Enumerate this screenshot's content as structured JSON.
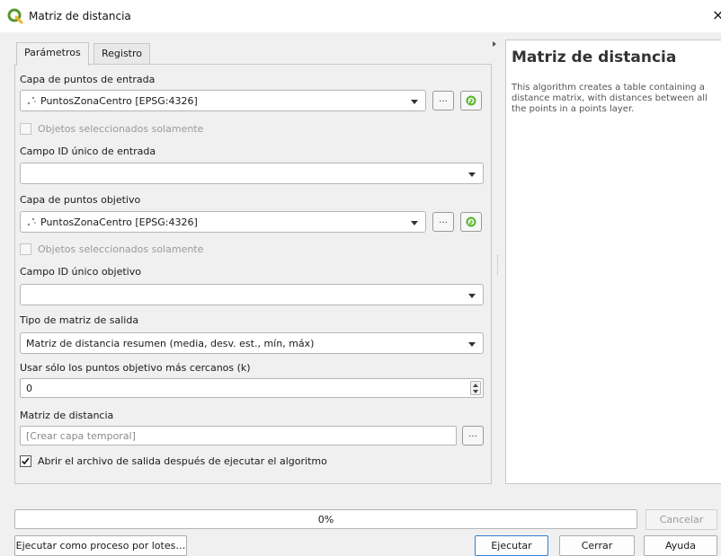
{
  "window": {
    "title": "Matriz de distancia",
    "close_glyph": "×",
    "icon": "qgis-logo-icon",
    "accent_color": "#589632"
  },
  "tabs": [
    {
      "label": "Parámetros",
      "active": true
    },
    {
      "label": "Registro",
      "active": false
    }
  ],
  "params": {
    "input_layer_label": "Capa de puntos de entrada",
    "input_layer_value": "PuntosZonaCentro [EPSG:4326]",
    "input_selected_only": "Objetos seleccionados solamente",
    "input_id_label": "Campo ID único de entrada",
    "input_id_value": "",
    "target_layer_label": "Capa de puntos objetivo",
    "target_layer_value": "PuntosZonaCentro [EPSG:4326]",
    "target_selected_only": "Objetos seleccionados solamente",
    "target_id_label": "Campo ID único objetivo",
    "target_id_value": "",
    "matrix_type_label": "Tipo de matriz de salida",
    "matrix_type_value": "Matriz de distancia resumen (media, desv. est., mín, máx)",
    "nearest_k_label": "Usar sólo los puntos objetivo más cercanos (k)",
    "nearest_k_value": "0",
    "output_label": "Matriz de distancia",
    "output_placeholder": "[Crear capa temporal]",
    "open_output_label": "Abrir el archivo de salida después de ejecutar el algoritmo",
    "open_output_checked": true,
    "browse_glyph": "..."
  },
  "help": {
    "title": "Matriz de distancia",
    "text": "This algorithm creates a table containing a distance matrix, with distances between all the points in a points layer."
  },
  "progress": {
    "value": 0,
    "label": "0%"
  },
  "buttons": {
    "cancel": "Cancelar",
    "batch": "Ejecutar como proceso por lotes…",
    "run": "Ejecutar",
    "close": "Cerrar",
    "help": "Ayuda"
  }
}
